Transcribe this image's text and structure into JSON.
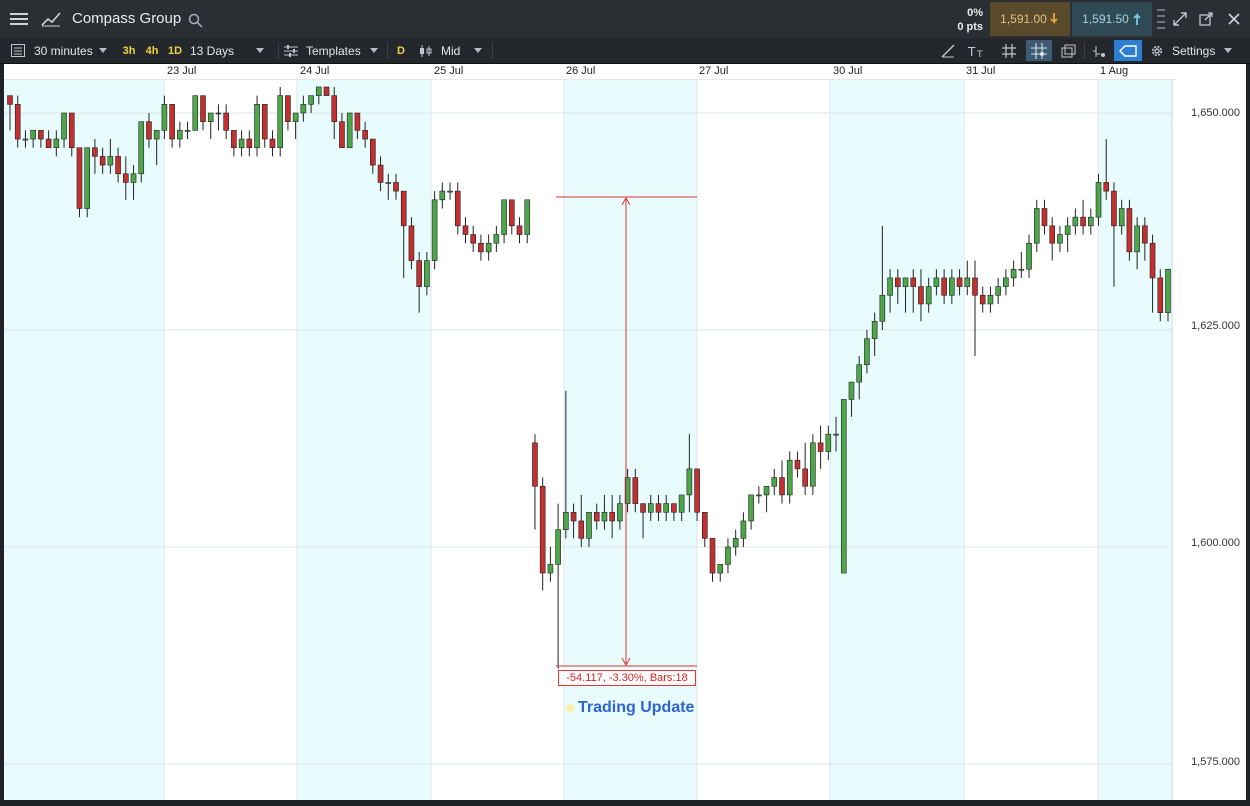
{
  "header": {
    "symbol": "Compass Group",
    "change_pct": "0%",
    "change_pts": "0 pts",
    "sell_price": "1,591.00",
    "buy_price": "1,591.50"
  },
  "toolbar": {
    "interval": "30 minutes",
    "presets": [
      "3h",
      "4h",
      "1D"
    ],
    "range": "13 Days",
    "templates": "Templates",
    "d_button": "D",
    "price_type": "Mid",
    "settings": "Settings"
  },
  "chart": {
    "dates": [
      {
        "label": "23 Jul"
      },
      {
        "label": "24 Jul"
      },
      {
        "label": "25 Jul"
      },
      {
        "label": "26 Jul"
      },
      {
        "label": "27 Jul"
      },
      {
        "label": "30 Jul"
      },
      {
        "label": "31 Jul"
      },
      {
        "label": "1 Aug"
      }
    ],
    "y_ticks": [
      "1,650.000",
      "1,625.000",
      "1,600.000",
      "1,575.000"
    ],
    "measure_text": "-54.117, -3.30%, Bars:18",
    "event_label": "Trading Update",
    "colors": {
      "up": "#4ea64a",
      "down": "#c33030",
      "shade": "#e8fbfd",
      "grid": "#dfe5ea"
    }
  },
  "chart_data": {
    "type": "candlestick",
    "y_ticks": [
      1650,
      1625,
      1600,
      1575
    ],
    "ylim": [
      1570,
      1654
    ],
    "x_ticks": [
      "23 Jul",
      "24 Jul",
      "25 Jul",
      "26 Jul",
      "27 Jul",
      "30 Jul",
      "31 Jul",
      "1 Aug"
    ],
    "candles": [
      [
        1652,
        1652,
        1648,
        1651
      ],
      [
        1651,
        1652,
        1646,
        1647
      ],
      [
        1647,
        1648,
        1646,
        1647
      ],
      [
        1647,
        1648,
        1646,
        1648
      ],
      [
        1648,
        1648,
        1646,
        1647
      ],
      [
        1647,
        1648,
        1646,
        1646
      ],
      [
        1646,
        1648,
        1645,
        1647
      ],
      [
        1647,
        1650,
        1646,
        1650
      ],
      [
        1650,
        1650,
        1645,
        1646
      ],
      [
        1646,
        1646,
        1638,
        1639
      ],
      [
        1639,
        1646,
        1638,
        1646
      ],
      [
        1646,
        1647,
        1643,
        1645
      ],
      [
        1645,
        1646,
        1643,
        1644
      ],
      [
        1644,
        1647,
        1643,
        1645
      ],
      [
        1645,
        1646,
        1642,
        1643
      ],
      [
        1643,
        1645,
        1640,
        1642
      ],
      [
        1642,
        1644,
        1640,
        1643
      ],
      [
        1643,
        1649,
        1642,
        1649
      ],
      [
        1649,
        1650,
        1646,
        1647
      ],
      [
        1647,
        1648,
        1644,
        1648
      ],
      [
        1648,
        1652,
        1647,
        1651
      ],
      [
        1651,
        1651,
        1646,
        1647
      ],
      [
        1647,
        1649,
        1646,
        1648
      ],
      [
        1648,
        1649,
        1647,
        1648
      ],
      [
        1648,
        1652,
        1648,
        1652
      ],
      [
        1652,
        1652,
        1648,
        1649
      ],
      [
        1649,
        1650,
        1647,
        1650
      ],
      [
        1650,
        1651,
        1648,
        1650
      ],
      [
        1650,
        1651,
        1647,
        1648
      ],
      [
        1648,
        1648,
        1645,
        1646
      ],
      [
        1646,
        1648,
        1645,
        1647
      ],
      [
        1647,
        1648,
        1645,
        1646
      ],
      [
        1646,
        1652,
        1645,
        1651
      ],
      [
        1651,
        1651,
        1646,
        1647
      ],
      [
        1647,
        1648,
        1645,
        1646
      ],
      [
        1646,
        1653,
        1645,
        1652
      ],
      [
        1652,
        1652,
        1648,
        1649
      ],
      [
        1649,
        1650,
        1647,
        1650
      ],
      [
        1650,
        1652,
        1649,
        1651
      ],
      [
        1651,
        1652,
        1650,
        1652
      ],
      [
        1652,
        1653,
        1651,
        1653
      ],
      [
        1653,
        1653,
        1652,
        1652
      ],
      [
        1652,
        1653,
        1647,
        1649
      ],
      [
        1649,
        1650,
        1646,
        1646
      ],
      [
        1646,
        1650,
        1646,
        1650
      ],
      [
        1650,
        1650,
        1647,
        1648
      ],
      [
        1648,
        1649,
        1646,
        1647
      ],
      [
        1647,
        1647,
        1643,
        1644
      ],
      [
        1644,
        1645,
        1641,
        1642
      ],
      [
        1642,
        1643,
        1640,
        1642
      ],
      [
        1642,
        1643,
        1640,
        1641
      ],
      [
        1641,
        1641,
        1631,
        1637
      ],
      [
        1637,
        1638,
        1632,
        1633
      ],
      [
        1633,
        1634,
        1627,
        1630
      ],
      [
        1630,
        1634,
        1629,
        1633
      ],
      [
        1633,
        1641,
        1632,
        1640
      ],
      [
        1640,
        1642,
        1639,
        1641
      ],
      [
        1641,
        1642,
        1640,
        1641
      ],
      [
        1641,
        1642,
        1636,
        1637
      ],
      [
        1637,
        1638,
        1635,
        1636
      ],
      [
        1636,
        1637,
        1634,
        1635
      ],
      [
        1635,
        1636,
        1633,
        1634
      ],
      [
        1634,
        1636,
        1633,
        1635
      ],
      [
        1635,
        1637,
        1634,
        1636
      ],
      [
        1636,
        1640,
        1635,
        1640
      ],
      [
        1640,
        1640,
        1636,
        1637
      ],
      [
        1637,
        1638,
        1635,
        1636
      ],
      [
        1636,
        1640,
        1635,
        1640
      ],
      [
        1612,
        1613,
        1602,
        1607
      ],
      [
        1607,
        1608,
        1595,
        1597
      ],
      [
        1597,
        1600,
        1596,
        1598
      ],
      [
        1598,
        1605,
        1586,
        1602
      ],
      [
        1602,
        1618,
        1601,
        1604
      ],
      [
        1604,
        1605,
        1601,
        1603
      ],
      [
        1603,
        1606,
        1600,
        1601
      ],
      [
        1601,
        1604,
        1600,
        1604
      ],
      [
        1604,
        1605,
        1602,
        1603
      ],
      [
        1603,
        1606,
        1602,
        1604
      ],
      [
        1604,
        1606,
        1601,
        1603
      ],
      [
        1603,
        1606,
        1602,
        1605
      ],
      [
        1605,
        1609,
        1604,
        1608
      ],
      [
        1608,
        1609,
        1604,
        1605
      ],
      [
        1605,
        1605,
        1601,
        1604
      ],
      [
        1604,
        1606,
        1603,
        1605
      ],
      [
        1605,
        1606,
        1603,
        1604
      ],
      [
        1604,
        1606,
        1603,
        1605
      ],
      [
        1605,
        1605,
        1603,
        1604
      ],
      [
        1604,
        1606,
        1603,
        1606
      ],
      [
        1606,
        1613,
        1604,
        1609
      ],
      [
        1609,
        1609,
        1603,
        1604
      ],
      [
        1604,
        1604,
        1600,
        1601
      ],
      [
        1601,
        1601,
        1596,
        1597
      ],
      [
        1597,
        1598,
        1596,
        1598
      ],
      [
        1598,
        1601,
        1597,
        1600
      ],
      [
        1600,
        1602,
        1599,
        1601
      ],
      [
        1601,
        1604,
        1600,
        1603
      ],
      [
        1603,
        1606,
        1602,
        1606
      ],
      [
        1606,
        1607,
        1605,
        1606
      ],
      [
        1606,
        1607,
        1604,
        1607
      ],
      [
        1607,
        1609,
        1606,
        1608
      ],
      [
        1608,
        1610,
        1605,
        1606
      ],
      [
        1606,
        1611,
        1605,
        1610
      ],
      [
        1610,
        1611,
        1608,
        1609
      ],
      [
        1609,
        1612,
        1606,
        1607
      ],
      [
        1607,
        1613,
        1606,
        1612
      ],
      [
        1612,
        1614,
        1609,
        1611
      ],
      [
        1611,
        1614,
        1610,
        1613
      ],
      [
        1613,
        1615,
        1611,
        1613
      ],
      [
        1597,
        1617,
        1597,
        1617
      ],
      [
        1617,
        1619,
        1615,
        1619
      ],
      [
        1619,
        1622,
        1617,
        1621
      ],
      [
        1621,
        1625,
        1620,
        1624
      ],
      [
        1624,
        1627,
        1622,
        1626
      ],
      [
        1626,
        1637,
        1625,
        1629
      ],
      [
        1629,
        1632,
        1627,
        1631
      ],
      [
        1631,
        1632,
        1628,
        1630
      ],
      [
        1630,
        1631,
        1627,
        1631
      ],
      [
        1631,
        1632,
        1627,
        1630
      ],
      [
        1630,
        1632,
        1626,
        1628
      ],
      [
        1628,
        1631,
        1627,
        1630
      ],
      [
        1630,
        1632,
        1629,
        1631
      ],
      [
        1631,
        1632,
        1628,
        1629
      ],
      [
        1629,
        1632,
        1628,
        1631
      ],
      [
        1631,
        1632,
        1629,
        1630
      ],
      [
        1630,
        1633,
        1629,
        1631
      ],
      [
        1631,
        1633,
        1622,
        1629
      ],
      [
        1629,
        1630,
        1627,
        1628
      ],
      [
        1628,
        1630,
        1627,
        1629
      ],
      [
        1629,
        1631,
        1628,
        1630
      ],
      [
        1630,
        1632,
        1629,
        1631
      ],
      [
        1631,
        1633,
        1630,
        1632
      ],
      [
        1632,
        1634,
        1631,
        1632
      ],
      [
        1632,
        1636,
        1631,
        1635
      ],
      [
        1635,
        1640,
        1634,
        1639
      ],
      [
        1639,
        1640,
        1636,
        1637
      ],
      [
        1637,
        1638,
        1633,
        1635
      ],
      [
        1635,
        1637,
        1634,
        1636
      ],
      [
        1636,
        1638,
        1634,
        1637
      ],
      [
        1637,
        1639,
        1636,
        1638
      ],
      [
        1638,
        1640,
        1636,
        1637
      ],
      [
        1637,
        1639,
        1636,
        1638
      ],
      [
        1638,
        1643,
        1637,
        1642
      ],
      [
        1642,
        1647,
        1640,
        1641
      ],
      [
        1641,
        1642,
        1630,
        1637
      ],
      [
        1637,
        1640,
        1636,
        1639
      ],
      [
        1639,
        1640,
        1633,
        1634
      ],
      [
        1634,
        1638,
        1632,
        1637
      ],
      [
        1637,
        1638,
        1633,
        1635
      ],
      [
        1635,
        1636,
        1627,
        1631
      ],
      [
        1631,
        1632,
        1626,
        1627
      ],
      [
        1627,
        1632,
        1626,
        1632
      ]
    ]
  }
}
